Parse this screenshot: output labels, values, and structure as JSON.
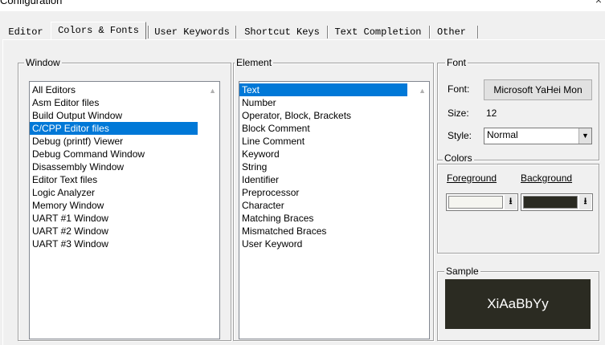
{
  "window": {
    "title": "Configuration",
    "close_glyph": "×"
  },
  "tabs": [
    {
      "label": "Editor",
      "active": false
    },
    {
      "label": "Colors & Fonts",
      "active": true
    },
    {
      "label": "User Keywords",
      "active": false
    },
    {
      "label": "Shortcut Keys",
      "active": false
    },
    {
      "label": "Text Completion",
      "active": false
    },
    {
      "label": "Other",
      "active": false
    }
  ],
  "window_group": {
    "label": "Window",
    "items": [
      "All Editors",
      "Asm Editor files",
      "Build Output Window",
      "C/CPP Editor files",
      "Debug (printf) Viewer",
      "Debug Command Window",
      "Disassembly Window",
      "Editor Text files",
      "Logic Analyzer",
      "Memory Window",
      "UART #1 Window",
      "UART #2 Window",
      "UART #3 Window"
    ],
    "selected": "C/CPP Editor files"
  },
  "element_group": {
    "label": "Element",
    "items": [
      "Text",
      "Number",
      "Operator, Block, Brackets",
      "Block Comment",
      "Line Comment",
      "Keyword",
      "String",
      "Identifier",
      "Preprocessor",
      "Character",
      "Matching Braces",
      "Mismatched Braces",
      "User Keyword"
    ],
    "selected": "Text"
  },
  "font_group": {
    "label": "Font",
    "font_label": "Font:",
    "font_button": "Microsoft YaHei Mon",
    "size_label": "Size:",
    "size_value": "12",
    "style_label": "Style:",
    "style_value": "Normal"
  },
  "colors_group": {
    "label": "Colors",
    "foreground_label": "Foreground",
    "background_label": "Background",
    "foreground_color": "#f5f5f0",
    "background_color": "#2b2b22"
  },
  "sample_group": {
    "label": "Sample",
    "text": "XiAaBbYy"
  },
  "colors": {
    "selection": "#0078d7",
    "sample_bg": "#2b2b22",
    "sample_fg": "#ffffff"
  }
}
